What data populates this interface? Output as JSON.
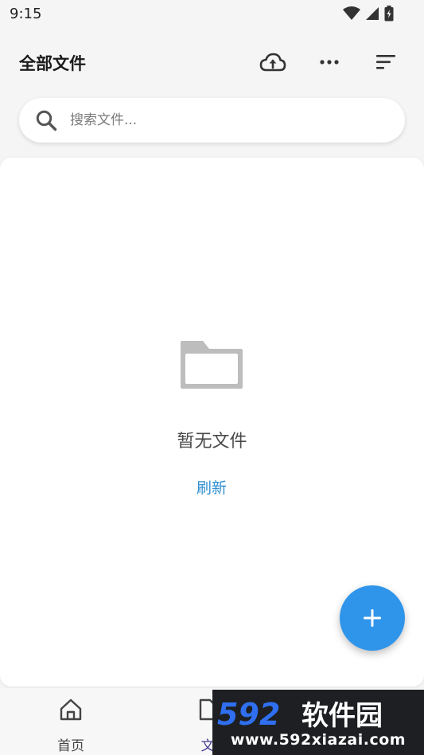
{
  "status_bar": {
    "time": "9:15",
    "icons": [
      "wifi-icon",
      "cell-signal-icon",
      "battery-icon"
    ]
  },
  "header": {
    "title": "全部文件",
    "actions": [
      "cloud-upload-icon",
      "more-icon",
      "sort-icon"
    ]
  },
  "search": {
    "placeholder": "搜索文件...",
    "value": ""
  },
  "empty_state": {
    "icon": "folder-icon",
    "message": "暂无文件",
    "refresh_label": "刷新"
  },
  "fab": {
    "icon": "plus-icon"
  },
  "bottom_nav": {
    "items": [
      {
        "icon": "home-icon",
        "label": "首页",
        "active": false
      },
      {
        "icon": "file-icon",
        "label": "文",
        "active": true
      }
    ]
  },
  "watermark": {
    "logo_text": "592软件园",
    "url": "www.592xiazai.com"
  },
  "colors": {
    "accent": "#2f95ea",
    "link": "#2f8fd0",
    "active_nav": "#4a3d8f",
    "background": "#f5f5f5",
    "card": "#ffffff"
  }
}
